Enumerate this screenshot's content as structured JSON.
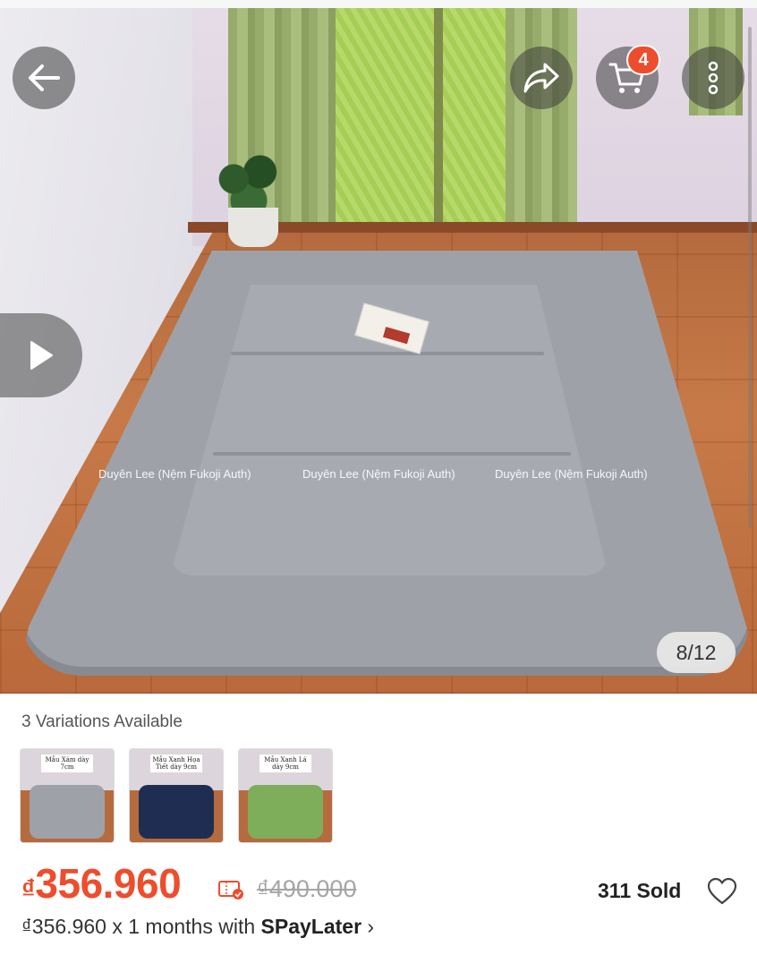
{
  "gallery": {
    "counter": "8/12",
    "watermarks": [
      "Duyên Lee (Nệm Fukoji Auth)",
      "Duyên Lee (Nệm Fukoji Auth)",
      "Duyên Lee (Nệm Fukoji Auth)"
    ]
  },
  "header": {
    "cart_count": "4",
    "icons": [
      "back-arrow-icon",
      "share-icon",
      "cart-icon",
      "more-icon"
    ]
  },
  "variations": {
    "label": "3 Variations Available",
    "items": [
      {
        "tag": "Mẫu Xám dày 7cm",
        "color": "#9ea2a8"
      },
      {
        "tag": "Mẫu Xanh Họa Tiết dày 9cm",
        "color": "#1f2d52"
      },
      {
        "tag": "Mẫu Xanh Lá dày 9cm",
        "color": "#7fae5a"
      }
    ]
  },
  "pricing": {
    "currency": "₫",
    "price": "356.960",
    "original_price": "₫490.000",
    "sold": "311 Sold",
    "paylater_prefix": "₫356.960 x 1 months with ",
    "paylater_brand": "SPayLater",
    "paylater_chevron": "›",
    "accent_color": "#ee4d2d"
  }
}
